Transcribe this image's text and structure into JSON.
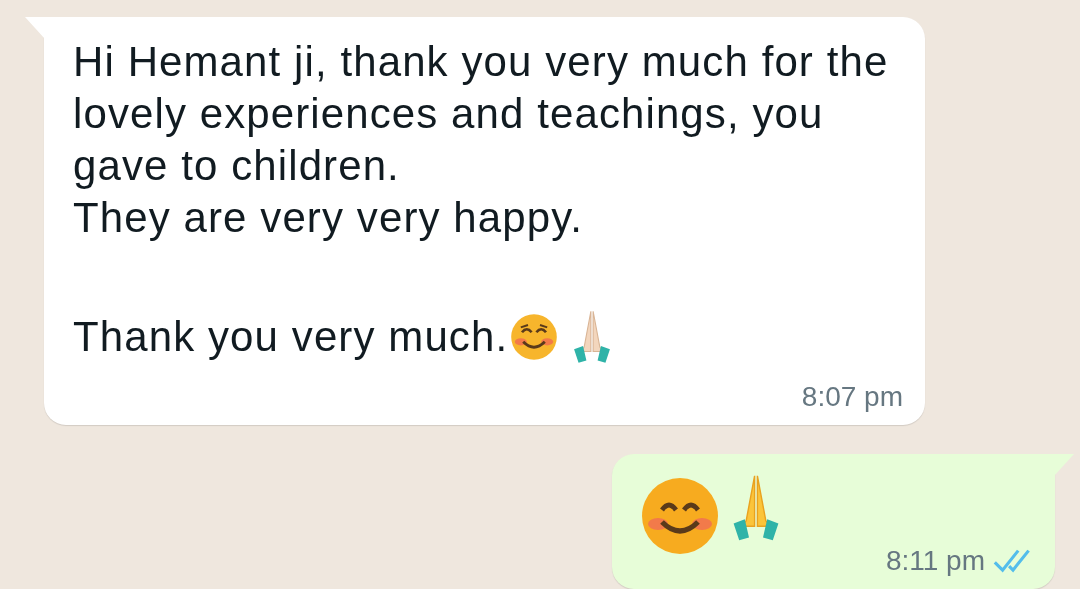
{
  "messages": [
    {
      "kind": "incoming",
      "paragraphs": [
        "Hi Hemant ji, thank you very much for the lovely experiences and teachings, you gave to children.\nThey are very very happy.",
        "Thank you very much."
      ],
      "time": "8:07 pm"
    },
    {
      "kind": "outgoing",
      "time": "8:11 pm",
      "read": true
    }
  ]
}
